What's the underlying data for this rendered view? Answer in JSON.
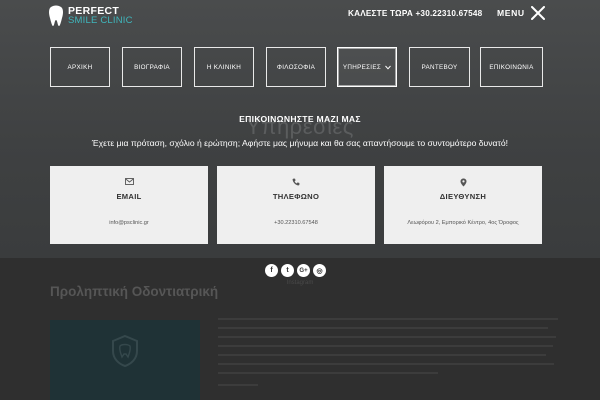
{
  "header": {
    "logo": {
      "line1": "PERFECT",
      "line2": "SMILE CLINIC"
    },
    "call": "ΚΑΛΕΣΤΕ ΤΩΡΑ +30.22310.67548",
    "menu_label": "MENU"
  },
  "nav": {
    "items": [
      {
        "label": "ΑΡΧΙΚΗ"
      },
      {
        "label": "ΒΙΟΓΡΑΦΙΑ"
      },
      {
        "label": "Η ΚΛΙΝΙΚΗ"
      },
      {
        "label": "ΦΙΛΟΣΟΦΙΑ"
      },
      {
        "label": "ΥΠΗΡΕΣΙΕΣ"
      },
      {
        "label": "ΡΑΝΤΕΒΟΥ"
      },
      {
        "label": "ΕΠΙΚΟΙΝΩΝΙΑ"
      }
    ],
    "active_index": 4
  },
  "contact": {
    "title": "ΕΠΙΚΟΙΝΩΝΗΣΤΕ ΜΑΖΙ ΜΑΣ",
    "subtitle": "Έχετε μια πρόταση, σχόλιο ή ερώτηση; Αφήστε μας μήνυμα και θα σας απαντήσουμε το συντομότερο δυνατό!",
    "cards": [
      {
        "icon": "envelope-icon",
        "title": "EMAIL",
        "value": "info@psclinic.gr"
      },
      {
        "icon": "phone-icon",
        "title": "ΤΗΛΕΦΩΝΟ",
        "value": "+30.22310.67548"
      },
      {
        "icon": "map-marker-icon",
        "title": "ΔΙΕΥΘΥΝΣΗ",
        "value": "Λεωφόρου 2, Εμπορικό Κέντρο, 4ος Όροφος"
      }
    ]
  },
  "social": [
    {
      "icon": "facebook-icon",
      "glyph": "f"
    },
    {
      "icon": "twitter-icon",
      "glyph": "t"
    },
    {
      "icon": "google-plus-icon",
      "glyph": "G+"
    },
    {
      "icon": "instagram-icon",
      "glyph": "◎"
    }
  ],
  "background": {
    "hero_title": "Υπηρεσίες",
    "section_title": "Προληπτική Οδοντιατρική",
    "small_label": "Instagram"
  },
  "colors": {
    "accent": "#3fb6bc",
    "overlay": "#3f4142",
    "card_bg": "#efefef"
  }
}
